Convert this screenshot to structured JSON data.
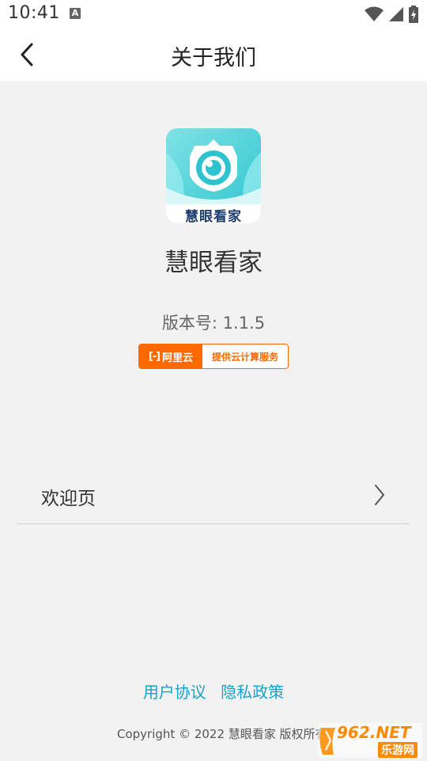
{
  "status_bar": {
    "time": "10:41",
    "notification_icon": "A",
    "icons": [
      "wifi-icon",
      "signal-icon",
      "battery-icon"
    ]
  },
  "header": {
    "title": "关于我们",
    "back_icon": "chevron-left-icon"
  },
  "app": {
    "logo_text": "慧眼看家",
    "name": "慧眼看家",
    "version": "版本号: 1.1.5"
  },
  "badge": {
    "brand_mark": "[-]",
    "brand": "阿里云",
    "text": "提供云计算服务",
    "color": "#ff6a00"
  },
  "menu": {
    "items": [
      {
        "label": "欢迎页",
        "icon": "chevron-right-icon"
      }
    ]
  },
  "footer": {
    "links": [
      "用户协议",
      "隐私政策"
    ],
    "copyright": "Copyright © 2022 慧眼看家 版权所有",
    "link_color": "#1aa3c9"
  },
  "watermark": {
    "top": "962.NET",
    "bottom": "乐游网"
  }
}
